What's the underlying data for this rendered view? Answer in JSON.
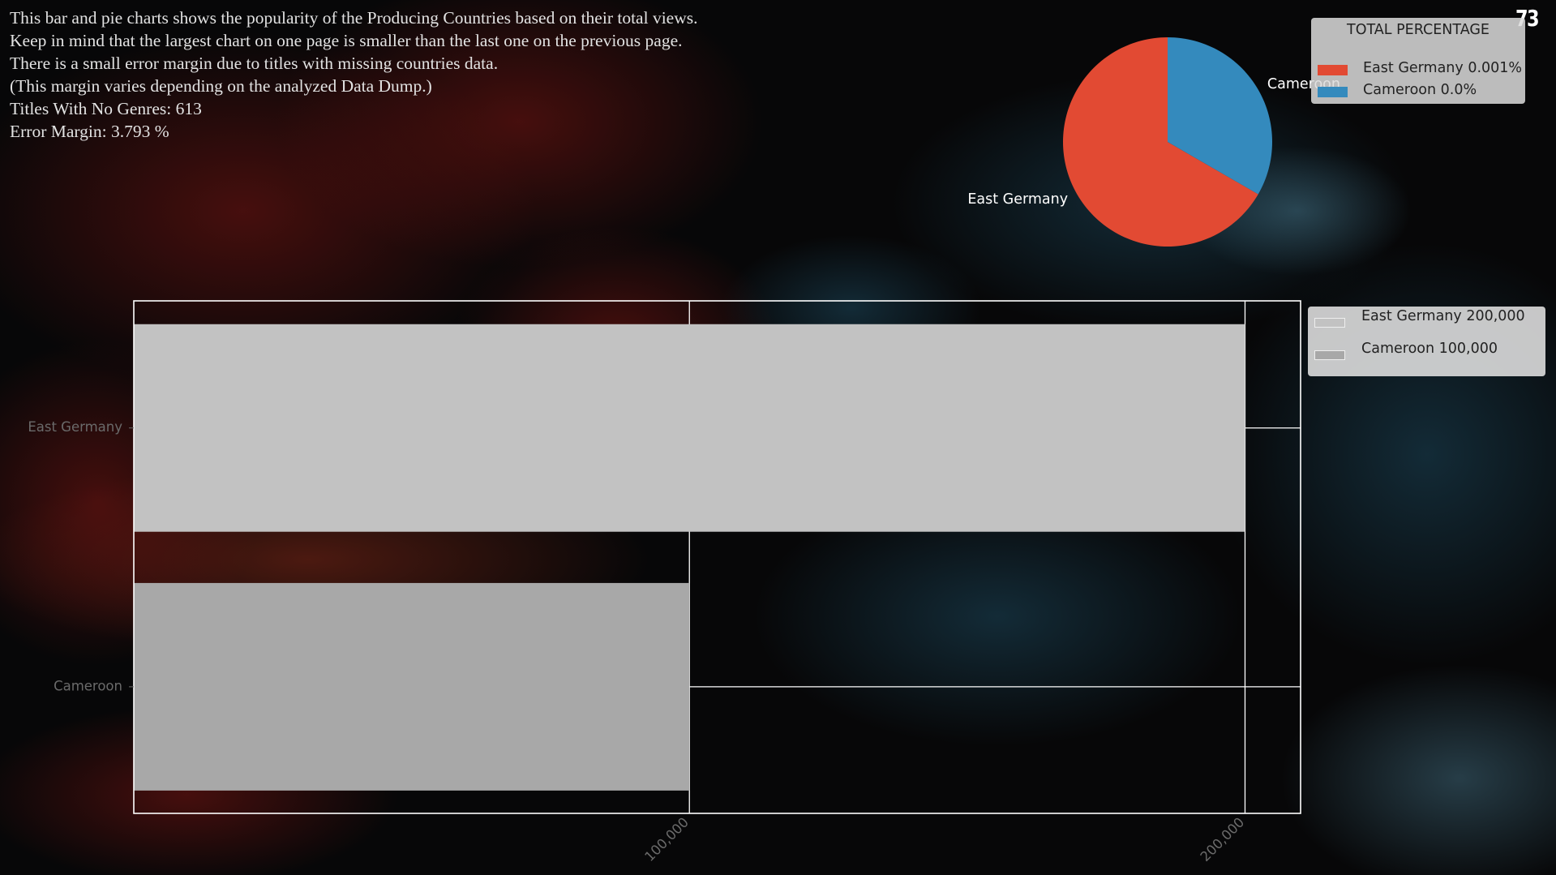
{
  "intro_lines": [
    "This bar and pie charts shows the popularity of the Producing Countries based on their total views.",
    "Keep in mind that the largest chart on one page is smaller than the last one on the previous page.",
    "There is a small error margin due to titles with missing countries data.",
    "(This margin varies depending on the analyzed Data Dump.)",
    "Titles With No Genres: 613",
    "Error Margin: 3.793 %"
  ],
  "page_number": "73",
  "colors": {
    "background": "#070708",
    "text": "#e2e2e2",
    "pie_east_germany": "#e24a33",
    "pie_cameroon": "#348abd",
    "bar_east_germany": "#c2c2c2",
    "bar_cameroon": "#a8a8a8",
    "axis_frame": "#ffffff",
    "tick_label": "#6a6a6a"
  },
  "chart_data": [
    {
      "type": "pie",
      "legend_title": "TOTAL PERCENTAGE",
      "legend_placement": "top-right",
      "slices": [
        {
          "label": "East Germany",
          "value": 200000,
          "legend": "East Germany 0.001%",
          "color": "#e24a33"
        },
        {
          "label": "Cameroon",
          "value": 100000,
          "legend": "Cameroon 0.0%",
          "color": "#348abd"
        }
      ]
    },
    {
      "type": "bar",
      "orientation": "horizontal",
      "categories": [
        "East Germany",
        "Cameroon"
      ],
      "values": [
        200000,
        100000
      ],
      "xlim": [
        0,
        210000
      ],
      "xticks": [
        100000,
        200000
      ],
      "xtick_labels": [
        "100,000",
        "200,000"
      ],
      "grid": true,
      "legend_placement": "right, outside axes",
      "legend": [
        "East Germany 200,000",
        "Cameroon 100,000"
      ],
      "bar_colors": [
        "#c2c2c2",
        "#a8a8a8"
      ]
    }
  ]
}
